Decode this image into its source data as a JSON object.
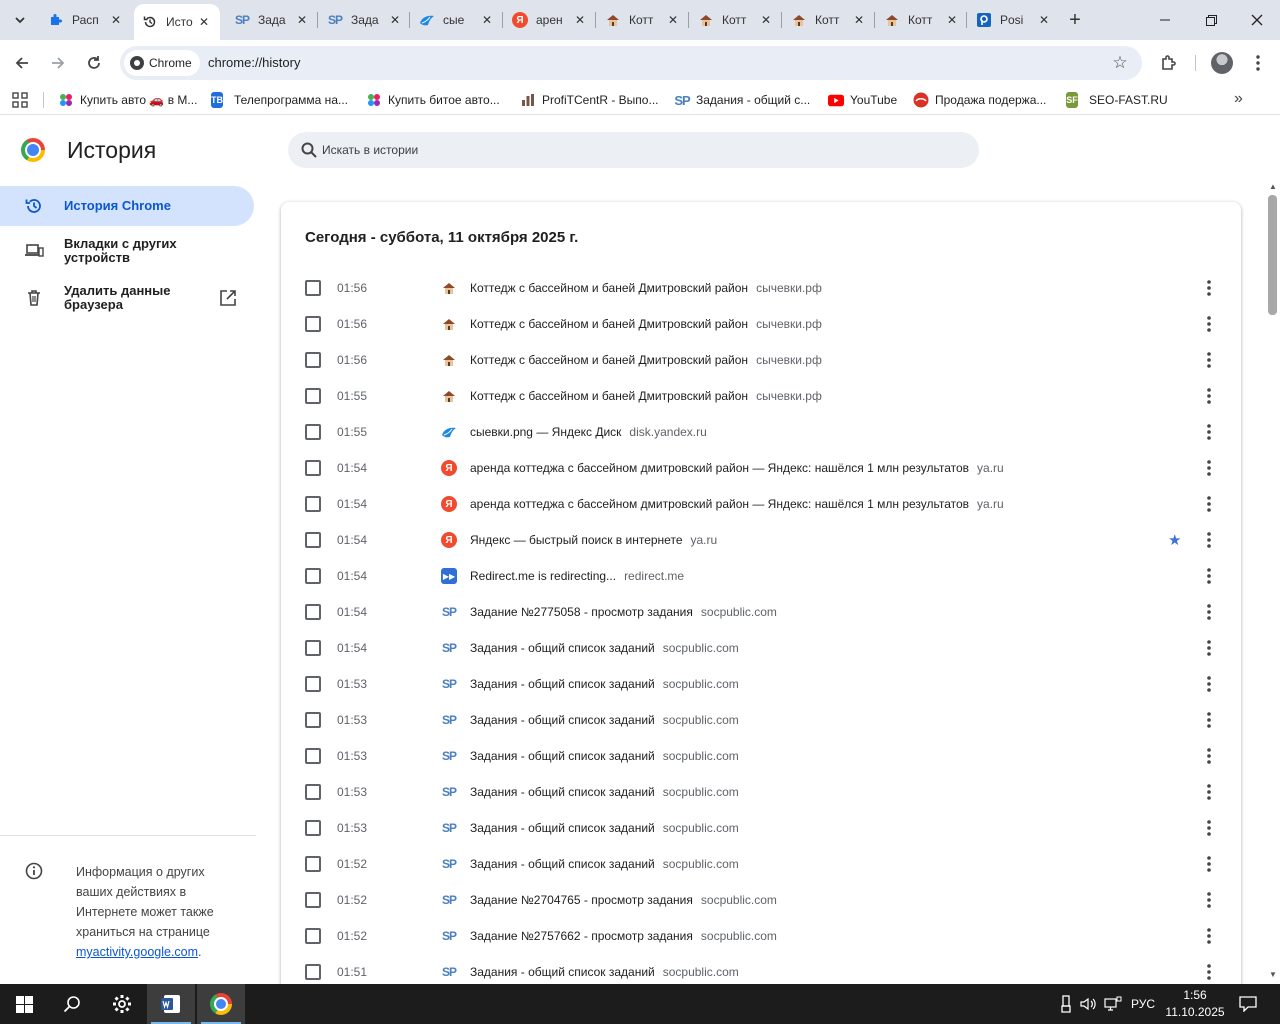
{
  "tabs": [
    {
      "label": "Расп",
      "icon": "puzzle-icon",
      "active": false
    },
    {
      "label": "Исто",
      "icon": "history-icon",
      "active": true
    },
    {
      "label": "Зада",
      "icon": "socpublic-icon",
      "active": false
    },
    {
      "label": "Зада",
      "icon": "socpublic-icon",
      "active": false
    },
    {
      "label": "сые",
      "icon": "yandex-disk-icon",
      "active": false
    },
    {
      "label": "арен",
      "icon": "yandex-icon",
      "active": false
    },
    {
      "label": "Котт",
      "icon": "cottage-icon",
      "active": false
    },
    {
      "label": "Котт",
      "icon": "cottage-icon",
      "active": false
    },
    {
      "label": "Котт",
      "icon": "cottage-icon",
      "active": false
    },
    {
      "label": "Котт",
      "icon": "cottage-icon",
      "active": false
    },
    {
      "label": "Posi",
      "icon": "posi-icon",
      "active": false
    }
  ],
  "toolbar": {
    "chip_label": "Chrome",
    "url": "chrome://history"
  },
  "bookmarks": [
    {
      "label": "Купить авто 🚗 в М...",
      "icon": "dots-icon"
    },
    {
      "label": "Телепрограмма на...",
      "icon": "tv-icon"
    },
    {
      "label": "Купить битое авто...",
      "icon": "dots-icon"
    },
    {
      "label": "ProfiTCentR - Выпо...",
      "icon": "bar-chart-icon"
    },
    {
      "label": "Задания - общий с...",
      "icon": "socpublic-icon"
    },
    {
      "label": "YouTube",
      "icon": "youtube-icon"
    },
    {
      "label": "Продажа подержа...",
      "icon": "drom-icon"
    },
    {
      "label": "SEO-FAST.RU",
      "icon": "seofast-icon"
    }
  ],
  "page": {
    "title": "История",
    "search_placeholder": "Искать в истории"
  },
  "sidebar": {
    "items": [
      {
        "label": "История Chrome",
        "icon": "history-icon",
        "active": true
      },
      {
        "label": "Вкладки с других устройств",
        "icon": "devices-icon",
        "active": false
      },
      {
        "label": "Удалить данные браузера",
        "icon": "trash-icon",
        "active": false
      }
    ],
    "info_text": "Информация о других ваших действиях в Интернете может также храниться на странице ",
    "info_link": "myactivity.google.com",
    "info_tail": "."
  },
  "history": {
    "heading": "Сегодня - суббота, 11 октября 2025 г.",
    "entries": [
      {
        "time": "01:56",
        "title": "Коттедж с бассейном и баней Дмитровский район",
        "domain": "сычевки.рф",
        "icon": "cottage-icon",
        "starred": false
      },
      {
        "time": "01:56",
        "title": "Коттедж с бассейном и баней Дмитровский район",
        "domain": "сычевки.рф",
        "icon": "cottage-icon",
        "starred": false
      },
      {
        "time": "01:56",
        "title": "Коттедж с бассейном и баней Дмитровский район",
        "domain": "сычевки.рф",
        "icon": "cottage-icon",
        "starred": false
      },
      {
        "time": "01:55",
        "title": "Коттедж с бассейном и баней Дмитровский район",
        "domain": "сычевки.рф",
        "icon": "cottage-icon",
        "starred": false
      },
      {
        "time": "01:55",
        "title": "сыевки.png — Яндекс Диск",
        "domain": "disk.yandex.ru",
        "icon": "yandex-disk-icon",
        "starred": false
      },
      {
        "time": "01:54",
        "title": "аренда коттеджа с бассейном дмитровский район — Яндекс: нашёлся 1 млн результатов",
        "domain": "ya.ru",
        "icon": "yandex-icon",
        "starred": false
      },
      {
        "time": "01:54",
        "title": "аренда коттеджа с бассейном дмитровский район — Яндекс: нашёлся 1 млн результатов",
        "domain": "ya.ru",
        "icon": "yandex-icon",
        "starred": false
      },
      {
        "time": "01:54",
        "title": "Яндекс — быстрый поиск в интернете",
        "domain": "ya.ru",
        "icon": "yandex-icon",
        "starred": true
      },
      {
        "time": "01:54",
        "title": "Redirect.me is redirecting...",
        "domain": "redirect.me",
        "icon": "redirect-icon",
        "starred": false
      },
      {
        "time": "01:54",
        "title": "Задание №2775058 - просмотр задания",
        "domain": "socpublic.com",
        "icon": "socpublic-icon",
        "starred": false
      },
      {
        "time": "01:54",
        "title": "Задания - общий список заданий",
        "domain": "socpublic.com",
        "icon": "socpublic-icon",
        "starred": false
      },
      {
        "time": "01:53",
        "title": "Задания - общий список заданий",
        "domain": "socpublic.com",
        "icon": "socpublic-icon",
        "starred": false
      },
      {
        "time": "01:53",
        "title": "Задания - общий список заданий",
        "domain": "socpublic.com",
        "icon": "socpublic-icon",
        "starred": false
      },
      {
        "time": "01:53",
        "title": "Задания - общий список заданий",
        "domain": "socpublic.com",
        "icon": "socpublic-icon",
        "starred": false
      },
      {
        "time": "01:53",
        "title": "Задания - общий список заданий",
        "domain": "socpublic.com",
        "icon": "socpublic-icon",
        "starred": false
      },
      {
        "time": "01:53",
        "title": "Задания - общий список заданий",
        "domain": "socpublic.com",
        "icon": "socpublic-icon",
        "starred": false
      },
      {
        "time": "01:52",
        "title": "Задания - общий список заданий",
        "domain": "socpublic.com",
        "icon": "socpublic-icon",
        "starred": false
      },
      {
        "time": "01:52",
        "title": "Задание №2704765 - просмотр задания",
        "domain": "socpublic.com",
        "icon": "socpublic-icon",
        "starred": false
      },
      {
        "time": "01:52",
        "title": "Задание №2757662 - просмотр задания",
        "domain": "socpublic.com",
        "icon": "socpublic-icon",
        "starred": false
      },
      {
        "time": "01:51",
        "title": "Задания - общий список заданий",
        "domain": "socpublic.com",
        "icon": "socpublic-icon",
        "starred": false
      }
    ]
  },
  "taskbar": {
    "apps": [
      {
        "name": "start",
        "icon": "windows-start-icon"
      },
      {
        "name": "search",
        "icon": "search-icon"
      },
      {
        "name": "settings",
        "icon": "gear-icon"
      },
      {
        "name": "word",
        "icon": "word-icon"
      },
      {
        "name": "chrome",
        "icon": "chrome-icon"
      }
    ],
    "language": "РУС",
    "time": "1:56",
    "date": "11.10.2025"
  },
  "colors": {
    "accent": "#0b57d0",
    "active_nav_bg": "#d3e3fd",
    "tabstrip_bg": "#dfe3eb",
    "omnibox_bg": "#e9eef6"
  }
}
